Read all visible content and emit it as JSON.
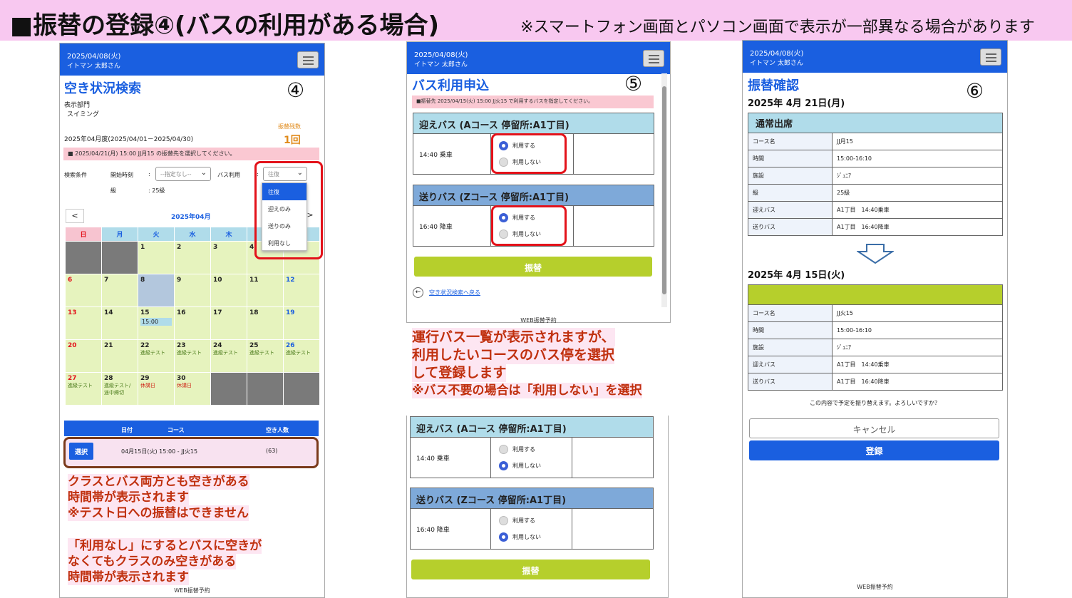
{
  "banner": {
    "title": "■振替の登録④(バスの利用がある場合)",
    "note": "※スマートフォン画面とパソコン画面で表示が一部異なる場合があります"
  },
  "header": {
    "date": "2025/04/08(火)",
    "user": "イトマン 太郎さん"
  },
  "panel4": {
    "title": "空き状況検索",
    "step": "④",
    "dept_label": "表示部門",
    "dept_value": "スイミング",
    "remaining_label": "振替残数",
    "remaining_value": "1回",
    "period": "2025年04月度(2025/04/01－2025/04/30)",
    "notice": "■ 2025/04/21(月) 15:00 JJ月15 の振替先を選択してください。",
    "search_label": "検索条件",
    "start_label": "開始時刻",
    "start_colon": ":",
    "start_value": "--指定なし--",
    "bus_label": "バス利用",
    "bus_colon": ":",
    "bus_value": "往復",
    "bus_options": [
      "往復",
      "迎えのみ",
      "送りのみ",
      "利用なし"
    ],
    "level_label": "級",
    "level_value": ": 25級",
    "cal_prev": "<",
    "cal_next": ">",
    "cal_month": "2025年04月",
    "weekdays": [
      "日",
      "月",
      "火",
      "水",
      "木",
      "金",
      "土"
    ],
    "days": {
      "d1": "1",
      "d2": "2",
      "d3": "3",
      "d4": "4",
      "d5": "5",
      "d6": "6",
      "d7": "7",
      "d8": "8",
      "d9": "9",
      "d10": "10",
      "d11": "11",
      "d12": "12",
      "d13": "13",
      "d14": "14",
      "d15": "15",
      "d16": "16",
      "d17": "17",
      "d18": "18",
      "d19": "19",
      "d20": "20",
      "d21": "21",
      "d22": "22",
      "d23": "23",
      "d24": "24",
      "d25": "25",
      "d26": "26",
      "d27": "27",
      "d28": "28",
      "d29": "29",
      "d30": "30"
    },
    "ev_test": "進級テスト",
    "ev_28": "進級テスト/",
    "ev_28b": "途中締切",
    "ev_closed": "休講日",
    "slot_15": "15:00",
    "result_cols": [
      "日付",
      "コース",
      "空き人数"
    ],
    "result_button": "選択",
    "result_text": "04月15日(火)  15:00 - JJ火15",
    "result_count": "(63)",
    "explain1": "クラスとバス両方とも空きがある",
    "explain2": "時間帯が表示されます",
    "explain3": "※テスト日への振替はできません",
    "explain4": "「利用なし」にするとバスに空きが",
    "explain5": "なくてもクラスのみ空きがある",
    "explain6": "時間帯が表示されます",
    "footer": "WEB振替予約"
  },
  "panel5": {
    "title": "バス利用申込",
    "step": "⑤",
    "notice": "■振替先 2025/04/15(火) 15:00 JJ火15 で利用するバスを指定してください。",
    "pickup_header": "迎えバス (Aコース 停留所:A1丁目)",
    "pickup_time": "14:40 乗車",
    "dropoff_header": "送りバス (Zコース 停留所:A1丁目)",
    "dropoff_time": "16:40 降車",
    "use": "利用する",
    "nouse": "利用しない",
    "submit": "振替",
    "back": "空き状況検索へ戻る",
    "footer": "WEB振替予約",
    "explain1": "運行バス一覧が表示されますが、",
    "explain2": "利用したいコースのバス停を選択",
    "explain3": "して登録します",
    "explain4": "※バス不要の場合は「利用しない」を選択"
  },
  "panel6": {
    "title": "振替確認",
    "step": "⑥",
    "from_date": "2025年 4月 21日(月)",
    "from_section": "通常出席",
    "from_rows": [
      [
        "コース名",
        "JJ月15"
      ],
      [
        "時間",
        "15:00-16:10"
      ],
      [
        "施設",
        "ｼﾞｭﾆｱ"
      ],
      [
        "級",
        "25級"
      ],
      [
        "迎えバス",
        "A1丁目　14:40乗車"
      ],
      [
        "送りバス",
        "A1丁目　16:40降車"
      ]
    ],
    "to_date": "2025年 4月 15日(火)",
    "to_rows": [
      [
        "コース名",
        "JJ火15"
      ],
      [
        "時間",
        "15:00-16:10"
      ],
      [
        "施設",
        "ｼﾞｭﾆｱ"
      ],
      [
        "迎えバス",
        "A1丁目　14:40乗車"
      ],
      [
        "送りバス",
        "A1丁目　16:40降車"
      ]
    ],
    "confirm": "この内容で予定を振り替えます。よろしいですか？",
    "cancel": "キャンセル",
    "register": "登録",
    "footer": "WEB振替予約"
  },
  "colors": {
    "primary": "#1a5fe0",
    "green": "#b6cf2c",
    "red": "#e3121a",
    "banner": "#f8c8f0"
  }
}
